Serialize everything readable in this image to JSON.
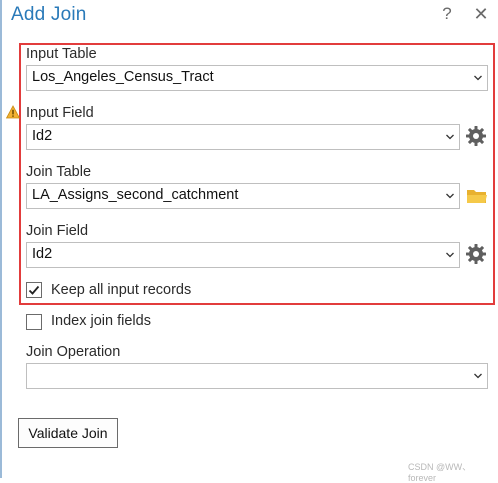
{
  "dialog": {
    "title": "Add Join",
    "help_label": "?",
    "close_label": "✕"
  },
  "input_table": {
    "label": "Input Table",
    "value": "Los_Angeles_Census_Tract"
  },
  "input_field": {
    "label": "Input Field",
    "value": "Id2"
  },
  "join_table": {
    "label": "Join Table",
    "value": "LA_Assigns_second_catchment"
  },
  "join_field": {
    "label": "Join Field",
    "value": "Id2"
  },
  "keep_all": {
    "label": "Keep all input records",
    "checked": true
  },
  "index_join": {
    "label": "Index join fields",
    "checked": false
  },
  "join_operation": {
    "label": "Join Operation",
    "value": ""
  },
  "validate_button": {
    "label": "Validate Join"
  },
  "watermark": "CSDN @WW、forever",
  "icons": {
    "warning": "warning-icon",
    "gear": "gear-icon",
    "folder": "folder-icon",
    "chevron": "chevron-down-icon",
    "check": "checkmark-icon"
  },
  "colors": {
    "title": "#2a7ab9",
    "highlight_border": "#e23c3c",
    "folder": "#e8b12f",
    "warning": "#f2b233"
  }
}
